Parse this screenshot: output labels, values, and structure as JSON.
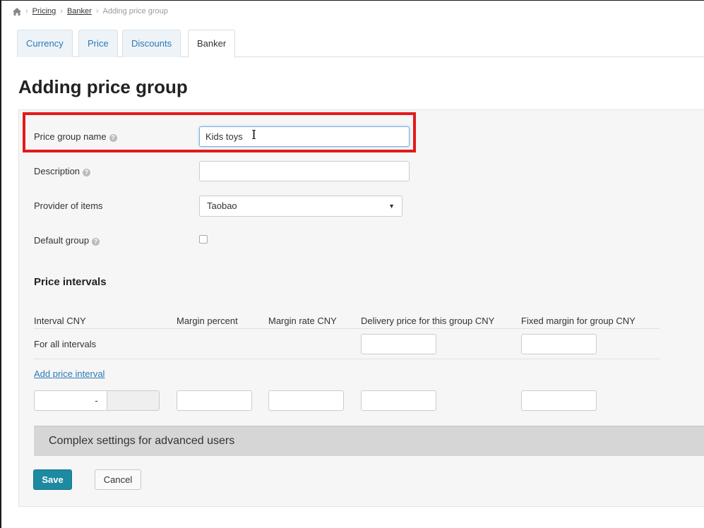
{
  "breadcrumb": {
    "home_icon": "home-icon",
    "items": [
      "Pricing",
      "Banker"
    ],
    "current": "Adding price group"
  },
  "tabs": [
    "Currency",
    "Price",
    "Discounts",
    "Banker"
  ],
  "active_tab": "Banker",
  "page_title": "Adding price group",
  "form": {
    "price_group_name": {
      "label": "Price group name",
      "value": "Kids toys"
    },
    "description": {
      "label": "Description",
      "value": ""
    },
    "provider": {
      "label": "Provider of items",
      "value": "Taobao"
    },
    "default_group": {
      "label": "Default group",
      "checked": false
    }
  },
  "price_intervals": {
    "title": "Price intervals",
    "columns": [
      "Interval CNY",
      "Margin percent",
      "Margin rate CNY",
      "Delivery price for this group CNY",
      "Fixed margin for group CNY"
    ],
    "all_intervals_label": "For all intervals",
    "add_link": "Add price interval",
    "range_separator": "-"
  },
  "advanced": {
    "label": "Complex settings for advanced users"
  },
  "buttons": {
    "save": "Save",
    "cancel": "Cancel"
  },
  "colors": {
    "accent": "#1d8aa1",
    "link": "#2a7ab8",
    "highlight": "#e21b1b"
  }
}
